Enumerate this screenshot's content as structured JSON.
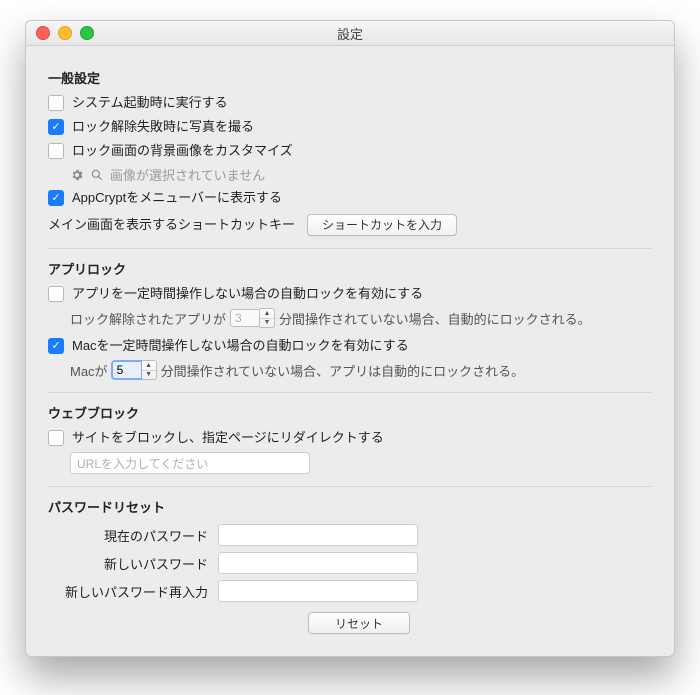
{
  "window": {
    "title": "設定"
  },
  "general": {
    "heading": "一般設定",
    "launch_at_startup": {
      "label": "システム起動時に実行する",
      "checked": false
    },
    "take_photo_on_fail": {
      "label": "ロック解除失敗時に写真を撮る",
      "checked": true
    },
    "custom_lock_bg": {
      "label": "ロック画面の背景画像をカスタマイズ",
      "checked": false,
      "no_image_text": "画像が選択されていません"
    },
    "show_in_menubar": {
      "label": "AppCryptをメニューバーに表示する",
      "checked": true
    },
    "shortcut_label": "メイン画面を表示するショートカットキー",
    "shortcut_button": "ショートカットを入力"
  },
  "applock": {
    "heading": "アプリロック",
    "idle_app": {
      "label": "アプリを一定時間操作しない場合の自動ロックを有効にする",
      "checked": false,
      "prefix": "ロック解除されたアプリが",
      "value": "3",
      "suffix": "分間操作されていない場合、自動的にロックされる。"
    },
    "idle_mac": {
      "label": "Macを一定時間操作しない場合の自動ロックを有効にする",
      "checked": true,
      "prefix": "Macが",
      "value": "5",
      "suffix": "分間操作されていない場合、アプリは自動的にロックされる。"
    }
  },
  "webblock": {
    "heading": "ウェブブロック",
    "enable": {
      "label": "サイトをブロックし、指定ページにリダイレクトする",
      "checked": false
    },
    "url_placeholder": "URLを入力してください"
  },
  "password": {
    "heading": "パスワードリセット",
    "current_label": "現在のパスワード",
    "new_label": "新しいパスワード",
    "confirm_label": "新しいパスワード再入力",
    "reset_button": "リセット"
  }
}
